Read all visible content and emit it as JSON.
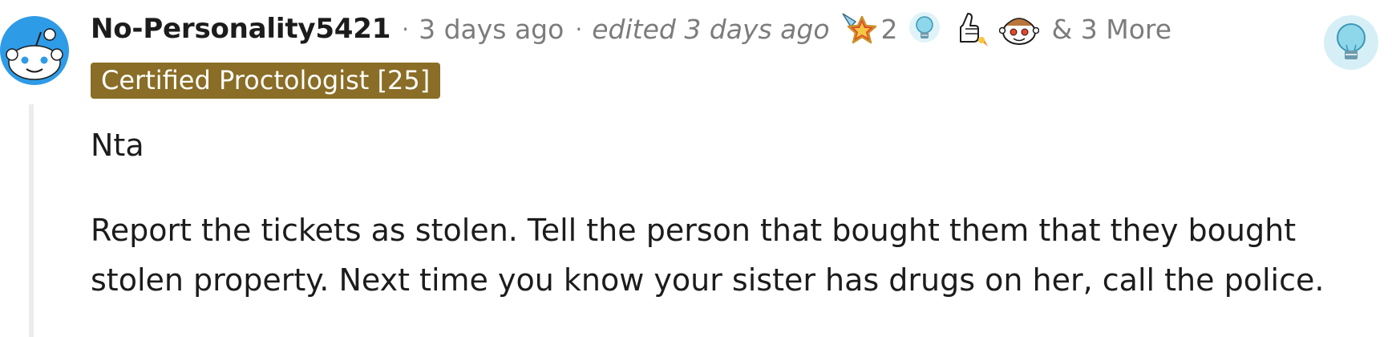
{
  "comment": {
    "author": "No-Personality5421",
    "separator": "·",
    "time": "3 days ago",
    "edited": "edited 3 days ago",
    "awards": [
      {
        "icon": "rocket-star-award-icon",
        "count": "2"
      },
      {
        "icon": "lightbulb-award-icon"
      },
      {
        "icon": "thumbs-up-rocket-award-icon"
      },
      {
        "icon": "snoo-face-award-icon"
      }
    ],
    "more_awards": "& 3 More",
    "flair": "Certified Proctologist [25]",
    "body": [
      "Nta",
      "Report the tickets as stolen. Tell the person that bought them that they bought stolen property. Next time you know your sister has drugs on her, call the police."
    ]
  },
  "colors": {
    "flair_bg": "#8a6d26",
    "meta_text": "#7c7c7c",
    "avatar_blue": "#2e9be7",
    "thread_line": "#ececec"
  }
}
